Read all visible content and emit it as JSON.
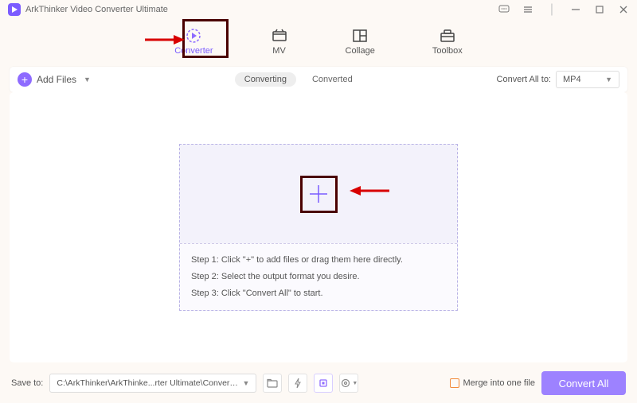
{
  "app": {
    "title": "ArkThinker Video Converter Ultimate"
  },
  "nav": {
    "converter": "Converter",
    "mv": "MV",
    "collage": "Collage",
    "toolbox": "Toolbox"
  },
  "toolbar": {
    "add_files": "Add Files",
    "tab_converting": "Converting",
    "tab_converted": "Converted",
    "convert_all_to": "Convert All to:",
    "format_selected": "MP4"
  },
  "drop": {
    "step1": "Step 1: Click \"+\" to add files or drag them here directly.",
    "step2": "Step 2: Select the output format you desire.",
    "step3": "Step 3: Click \"Convert All\" to start."
  },
  "bottom": {
    "save_to": "Save to:",
    "path": "C:\\ArkThinker\\ArkThinke...rter Ultimate\\Converted",
    "merge": "Merge into one file",
    "convert_all": "Convert All"
  }
}
